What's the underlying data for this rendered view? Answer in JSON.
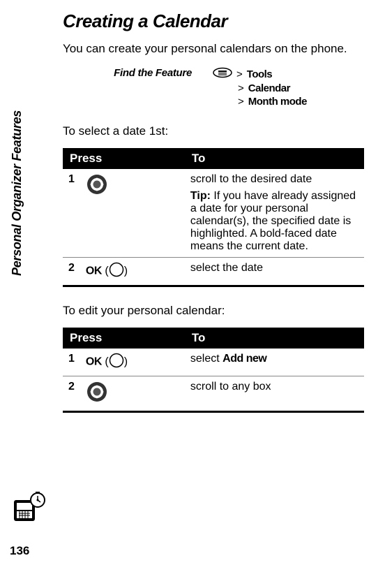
{
  "sidebar": {
    "section_label": "Personal Organizer Features",
    "page_number": "136"
  },
  "page": {
    "title": "Creating a Calendar",
    "intro": "You can create your personal calendars on the phone.",
    "feature_label": "Find the Feature",
    "path_items": [
      "Tools",
      "Calendar",
      "Month mode"
    ],
    "select_date_text": "To select a date 1st:",
    "edit_calendar_text": "To edit your personal calendar:"
  },
  "table1": {
    "header_press": "Press",
    "header_to": "To",
    "row1": {
      "num": "1",
      "desc": "scroll to the desired date",
      "tip_label": "Tip:",
      "tip_text": " If you have already assigned a date for your personal calendar(s), the specified date is highlighted. A bold-faced date means the current date."
    },
    "row2": {
      "num": "2",
      "ok": "OK",
      "desc": "select the date"
    }
  },
  "table2": {
    "header_press": "Press",
    "header_to": "To",
    "row1": {
      "num": "1",
      "ok": "OK",
      "desc_prefix": "select ",
      "desc_bold": "Add new"
    },
    "row2": {
      "num": "2",
      "desc": "scroll to any box"
    }
  }
}
